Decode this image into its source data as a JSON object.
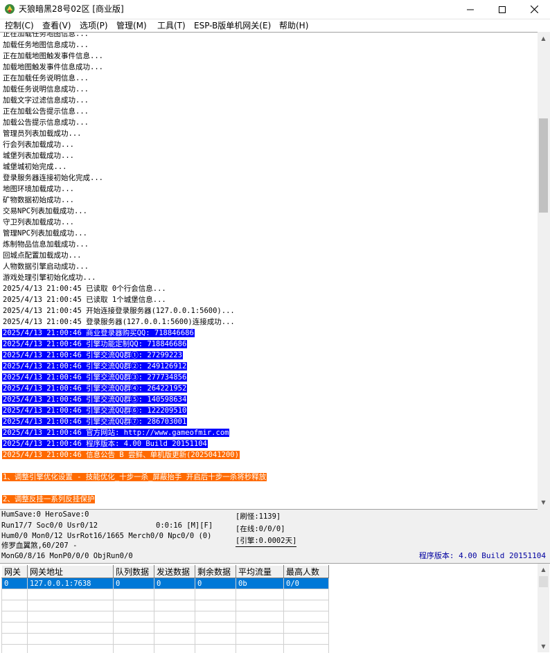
{
  "window": {
    "title": "天狼暗黑28号02区 [商业版]"
  },
  "menu": [
    "控制(C)",
    "查看(V)",
    "选项(P)",
    "管理(M)",
    "工具(T)",
    "ESP-B版单机网关(E)",
    "帮助(H)"
  ],
  "log": {
    "lines": [
      {
        "text": "正在加载任务地图信息...",
        "style": "normal"
      },
      {
        "text": "加载任务地图信息成功...",
        "style": "normal"
      },
      {
        "text": "正在加载地图触发事件信息...",
        "style": "normal"
      },
      {
        "text": "加载地图触发事件信息成功...",
        "style": "normal"
      },
      {
        "text": "正在加载任务说明信息...",
        "style": "normal"
      },
      {
        "text": "加载任务说明信息成功...",
        "style": "normal"
      },
      {
        "text": "加载文字过滤信息成功...",
        "style": "normal"
      },
      {
        "text": "正在加载公告提示信息...",
        "style": "normal"
      },
      {
        "text": "加载公告提示信息成功...",
        "style": "normal"
      },
      {
        "text": "管理员列表加载成功...",
        "style": "normal"
      },
      {
        "text": "行会列表加载成功...",
        "style": "normal"
      },
      {
        "text": "城堡列表加载成功...",
        "style": "normal"
      },
      {
        "text": "城堡城初始完成...",
        "style": "normal"
      },
      {
        "text": "登录服务器连接初始化完成...",
        "style": "normal"
      },
      {
        "text": "地图环境加载成功...",
        "style": "normal"
      },
      {
        "text": "矿物数据初始成功...",
        "style": "normal"
      },
      {
        "text": "交易NPC列表加载成功...",
        "style": "normal"
      },
      {
        "text": "守卫列表加载成功...",
        "style": "normal"
      },
      {
        "text": "管理NPC列表加载成功...",
        "style": "normal"
      },
      {
        "text": "炼制物品信息加载成功...",
        "style": "normal"
      },
      {
        "text": "回城点配置加载成功...",
        "style": "normal"
      },
      {
        "text": "人物数据引擎启动成功...",
        "style": "normal"
      },
      {
        "text": "游戏处理引擎初始化成功...",
        "style": "normal"
      },
      {
        "text": "2025/4/13 21:00:45 已读取 0个行会信息...",
        "style": "normal"
      },
      {
        "text": "2025/4/13 21:00:45 已读取 1个城堡信息...",
        "style": "normal"
      },
      {
        "text": "2025/4/13 21:00:45 开始连接登录服务器(127.0.0.1:5600)...",
        "style": "normal"
      },
      {
        "text": "2025/4/13 21:00:45 登录服务器(127.0.0.1:5600)连接成功...",
        "style": "normal"
      },
      {
        "text": "2025/4/13 21:00:46 商业登录器购买QQ: 718846686",
        "style": "blue"
      },
      {
        "text": "2025/4/13 21:00:46 引擎功能定制QQ: 718846686",
        "style": "blue"
      },
      {
        "text": "2025/4/13 21:00:46 引擎交流QQ群①: 27299223",
        "style": "blue"
      },
      {
        "text": "2025/4/13 21:00:46 引擎交流QQ群②: 249126912",
        "style": "blue"
      },
      {
        "text": "2025/4/13 21:00:46 引擎交流QQ群③: 277734856",
        "style": "blue"
      },
      {
        "text": "2025/4/13 21:00:46 引擎交流QQ群④: 264221952",
        "style": "blue"
      },
      {
        "text": "2025/4/13 21:00:46 引擎交流QQ群⑤: 140598634",
        "style": "blue"
      },
      {
        "text": "2025/4/13 21:00:46 引擎交流QQ群⑥: 122209510",
        "style": "blue"
      },
      {
        "text": "2025/4/13 21:00:46 引擎交流QQ群⑦: 286703001",
        "style": "blue"
      },
      {
        "text": "2025/4/13 21:00:46 官方网站: http://www.gameofmir.com",
        "style": "blue"
      },
      {
        "text": "2025/4/13 21:00:46 程序版本: 4.00 Build 20151104",
        "style": "blue"
      },
      {
        "text": "2025/4/13 21:00:46 信息公告 B 尝鲜、单机版更新(2025041200)",
        "style": "orange"
      },
      {
        "text": "",
        "style": "normal"
      },
      {
        "text": "1、调整引擎优化设置 - 技能优化_十步一杀_屏蔽抬手 开启后十步一杀将秒释放",
        "style": "orange"
      },
      {
        "text": "",
        "style": "normal"
      },
      {
        "text": "2、调整反挂一系列反挂保护",
        "style": "orange"
      }
    ]
  },
  "status": {
    "line1": "HumSave:0 HeroSave:0",
    "line2": "Run17/7 Soc0/0 Usr0/12",
    "timer": "0:0:16 [M][F]",
    "line3": "Hum0/0 Mon0/12 UsrRot16/1665 Merch0/0 Npc0/0 (0)",
    "line4": "修罗血翼煞,60/207 -",
    "line5": "MonG0/8/16 MonP0/0/0 ObjRun0/0",
    "refresh": "[刷怪:1139]",
    "online": "[在线:0/0/0]",
    "engine": "[引擎:0.0002天]",
    "version": "程序版本: 4.00 Build 20151104"
  },
  "gate_table": {
    "headers": [
      "网关",
      "网关地址",
      "队列数据",
      "发送数据",
      "剩余数据",
      "平均流量",
      "最高人数"
    ],
    "rows": [
      [
        "0",
        "127.0.0.1:7638",
        "0",
        "0",
        "0",
        "0b",
        "0/0"
      ]
    ]
  }
}
